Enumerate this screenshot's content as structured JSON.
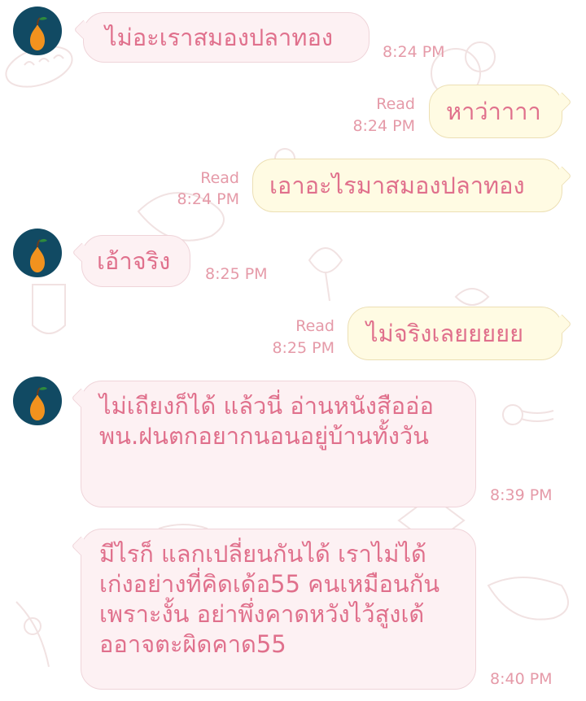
{
  "messages": [
    {
      "text": "ไม่อะเราสมองปลาทอง",
      "time": "8:24 PM"
    },
    {
      "text": "หาว่าาาา",
      "read": "Read",
      "time": "8:24 PM"
    },
    {
      "text": "เอาอะไรมาสมองปลาทอง",
      "read": "Read",
      "time": "8:24 PM"
    },
    {
      "text": "เอ้าจริง",
      "time": "8:25 PM"
    },
    {
      "text": "ไม่จริงเลยยยยย",
      "read": "Read",
      "time": "8:25 PM"
    },
    {
      "text": "ไม่เถียงก็ได้ แล้วนี่ อ่านหนังสืออ่อ พน.ฝนตกอยากนอนอยู่บ้านทั้งวัน",
      "time": "8:39 PM"
    },
    {
      "text": "มีไรก็ แลกเปลี่ยนกันได้ เราไม่ได้เก่งอย่างที่คิดเด้อ55 คนเหมือนกัน เพราะงั้น อย่าพึ่งคาดหวังไว้สูงเด้ออาจตะผิดคาด55",
      "time": "8:40 PM"
    }
  ],
  "avatar": {
    "icon": "orange-pear-icon",
    "bg_color": "#114a63",
    "fruit_color": "#f2921e"
  },
  "colors": {
    "text": "#e0708c",
    "meta": "#e59aa8",
    "incoming_bg": "#fdf1f3",
    "outgoing_bg": "#fffbe3"
  }
}
